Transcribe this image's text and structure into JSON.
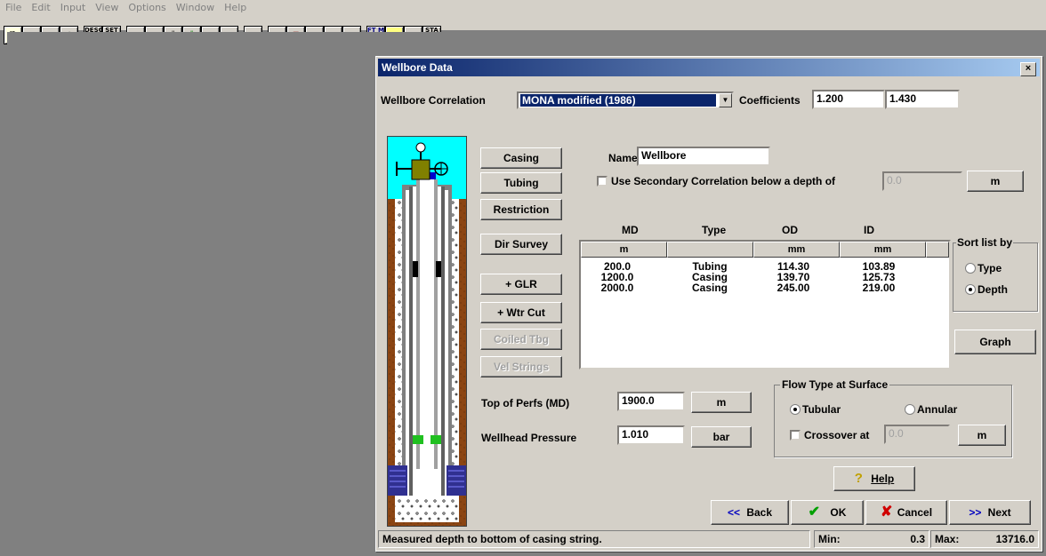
{
  "menu": [
    "File",
    "Edit",
    "Input",
    "View",
    "Options",
    "Window",
    "Help"
  ],
  "toolbar_icons": [
    "new-icon",
    "open-icon",
    "save-icon",
    "print-icon",
    "desc-icon",
    "setup-icon",
    "fluid-icon",
    "ipr-icon",
    "wellbore-icon",
    "choke-icon",
    "valve-icon",
    "fire-icon",
    "report-icon",
    "edit-icon",
    "copy-icon",
    "zoom-icon",
    "chart-icon",
    "paste-icon",
    "units-icon",
    "calc-icon",
    "stop-icon",
    "status-icon"
  ],
  "toolbar_labels": {
    "desc": "DESC",
    "setup": "SET UP",
    "units": "FT M",
    "status": "STA TUS"
  },
  "dialog": {
    "title": "Wellbore Data",
    "close": "×",
    "correlation_label": "Wellbore Correlation",
    "correlation_value": "MONA modified (1986)",
    "coefficients_label": "Coefficients",
    "coef1": "1.200",
    "coef2": "1.430",
    "buttons": {
      "casing": "Casing",
      "tubing": "Tubing",
      "restriction": "Restriction",
      "dir_survey": "Dir Survey",
      "glr": "+ GLR",
      "wtr_cut": "+ Wtr Cut",
      "coiled": "Coiled Tbg",
      "vel": "Vel Strings"
    },
    "name_label": "Name",
    "name_value": "Wellbore",
    "secondary_label": "Use Secondary Correlation below a depth of",
    "secondary_value": "0.0",
    "secondary_unit": "m",
    "table": {
      "columns": [
        "MD",
        "Type",
        "OD",
        "ID"
      ],
      "units": [
        "m",
        "",
        "mm",
        "mm",
        ""
      ],
      "rows": [
        [
          "200.0",
          "Tubing",
          "114.30",
          "103.89"
        ],
        [
          "1200.0",
          "Casing",
          "139.70",
          "125.73"
        ],
        [
          "2000.0",
          "Casing",
          "245.00",
          "219.00"
        ]
      ]
    },
    "sort": {
      "title": "Sort list by",
      "type": "Type",
      "depth": "Depth",
      "selected": "Depth"
    },
    "graph": "Graph",
    "perfs_label": "Top of Perfs (MD)",
    "perfs_value": "1900.0",
    "perfs_unit": "m",
    "whp_label": "Wellhead Pressure",
    "whp_value": "1.010",
    "whp_unit": "bar",
    "flow": {
      "title": "Flow Type at Surface",
      "tubular": "Tubular",
      "annular": "Annular",
      "selected": "Tubular",
      "crossover_label": "Crossover at",
      "crossover_value": "0.0",
      "crossover_unit": "m"
    },
    "help": "Help",
    "nav": {
      "back": "Back",
      "ok": "OK",
      "cancel": "Cancel",
      "next": "Next"
    },
    "status": {
      "message": "Measured depth to bottom of casing string.",
      "min_label": "Min:",
      "min_value": "0.3",
      "max_label": "Max:",
      "max_value": "13716.0"
    }
  }
}
